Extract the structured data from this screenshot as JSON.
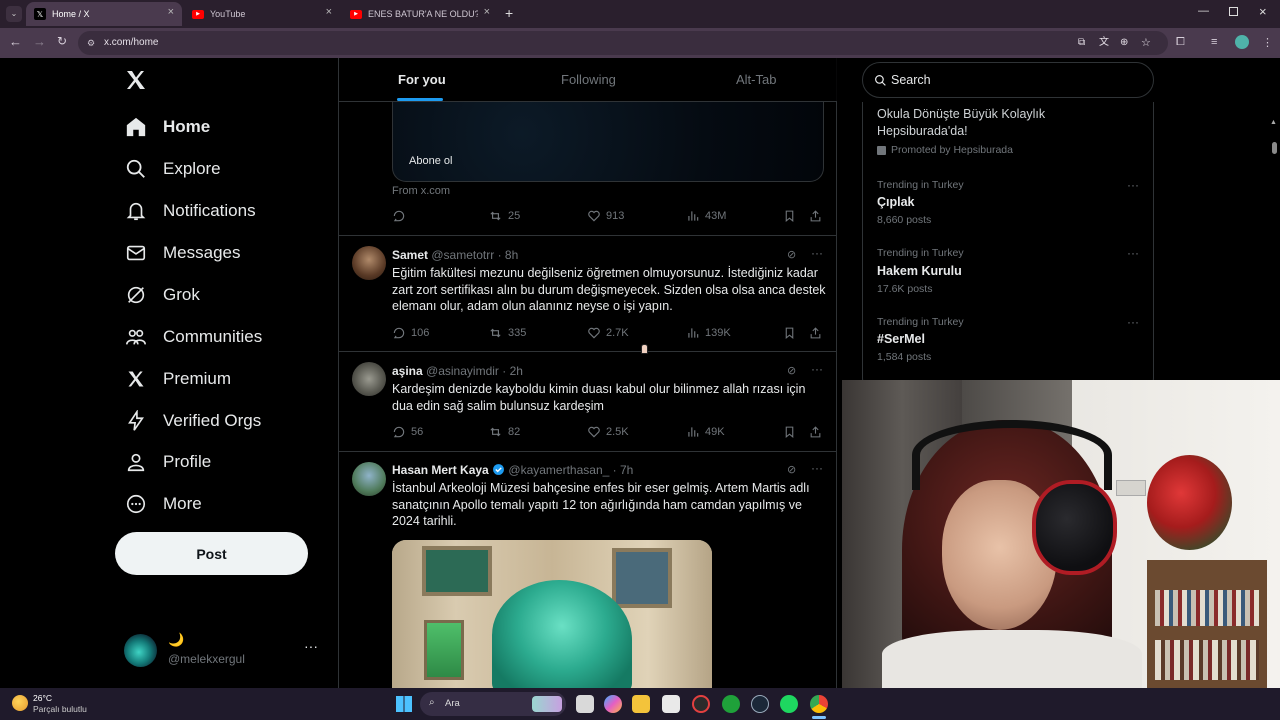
{
  "browser": {
    "tabs": [
      {
        "title": "Home / X",
        "active": true
      },
      {
        "title": "YouTube",
        "active": false
      },
      {
        "title": "ENES BATUR'A NE OLDU? - You",
        "active": false
      }
    ],
    "url": "x.com/home"
  },
  "sidebar": {
    "items": [
      {
        "label": "Home",
        "icon": "home-icon",
        "bold": true
      },
      {
        "label": "Explore",
        "icon": "search-icon"
      },
      {
        "label": "Notifications",
        "icon": "bell-icon"
      },
      {
        "label": "Messages",
        "icon": "mail-icon"
      },
      {
        "label": "Grok",
        "icon": "grok-icon"
      },
      {
        "label": "Communities",
        "icon": "people-icon"
      },
      {
        "label": "Premium",
        "icon": "x-logo-icon"
      },
      {
        "label": "Verified Orgs",
        "icon": "lightning-icon"
      },
      {
        "label": "Profile",
        "icon": "person-icon"
      },
      {
        "label": "More",
        "icon": "more-circle-icon"
      }
    ],
    "post_label": "Post",
    "account": {
      "display_name": "🌙",
      "handle": "@melekxergul"
    }
  },
  "timeline": {
    "tabs": [
      "For you",
      "Following",
      "Alt-Tab"
    ],
    "card": {
      "button_text": "Abone ol",
      "source": "From x.com"
    },
    "top_actions": {
      "retweets": "25",
      "likes": "913",
      "views": "43M"
    },
    "tweets": [
      {
        "name": "Samet",
        "handle": "@sametotrr",
        "time": "· 8h",
        "text": "Eğitim fakültesi mezunu değilseniz öğretmen olmuyorsunuz. İstediğiniz kadar zart zort sertifikası alın bu durum değişmeyecek. Sizden olsa olsa anca destek elemanı olur, adam olun alanınız neyse o işi yapın.",
        "replies": "106",
        "retweets": "335",
        "likes": "2.7K",
        "views": "139K"
      },
      {
        "name": "aşina",
        "handle": "@asinayimdir",
        "time": "· 2h",
        "text": "Kardeşim denizde kayboldu kimin duası kabul olur bilinmez allah rızası için dua edin sağ salim bulunsuz kardeşim",
        "replies": "56",
        "retweets": "82",
        "likes": "2.5K",
        "views": "49K"
      },
      {
        "name": "Hasan Mert Kaya",
        "handle": "@kayamerthasan_",
        "time": "· 7h",
        "text": "İstanbul Arkeoloji Müzesi bahçesine enfes bir eser gelmiş. Artem Martis adlı sanatçının Apollo temalı yapıtı 12 ton ağırlığında ham camdan yapılmış ve 2024 tarihli."
      }
    ]
  },
  "right": {
    "search_placeholder": "Search",
    "promo": {
      "title": "Okula Dönüşte Büyük Kolaylık Hepsiburada'da!",
      "promoted": "Promoted by Hepsiburada"
    },
    "trends": [
      {
        "category": "Trending in Turkey",
        "name": "Çıplak",
        "count": "8,660 posts"
      },
      {
        "category": "Trending in Turkey",
        "name": "Hakem Kurulu",
        "count": "17.6K posts"
      },
      {
        "category": "Trending in Turkey",
        "name": "#SerMel",
        "count": "1,584 posts"
      }
    ]
  },
  "taskbar": {
    "weather_temp": "26°C",
    "weather_desc": "Parçalı bulutlu",
    "search_label": "Ara"
  },
  "colors": {
    "accent": "#1d9bf0",
    "bg": "#000000",
    "border": "#2f3336",
    "muted": "#71767b"
  }
}
